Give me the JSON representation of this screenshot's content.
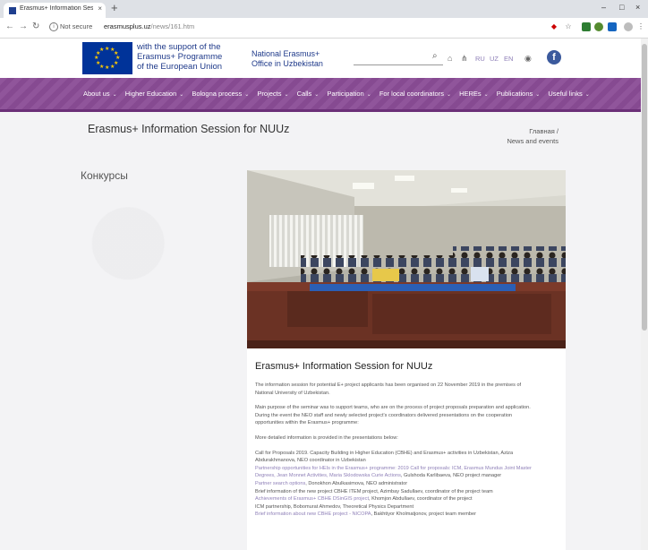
{
  "browser": {
    "tab_title": "Erasmus+ Information Session fo",
    "tab_close": "×",
    "new_tab": "+",
    "security_label": "Not secure",
    "url_host": "erasmusplus.uz",
    "url_path": "/news/161.htm",
    "window_controls": [
      "–",
      "□",
      "×"
    ]
  },
  "header": {
    "eu_text": [
      "with the support of the",
      "Erasmus+ Programme",
      "of the European Union"
    ],
    "office_text": [
      "National Erasmus+",
      "Office in Uzbekistan"
    ],
    "languages": [
      "RU",
      "UZ",
      "EN"
    ]
  },
  "nav": {
    "items": [
      "About us",
      "Higher Education",
      "Bologna process",
      "Projects",
      "Calls",
      "Participation",
      "For local coordinators",
      "HEREs",
      "Publications",
      "Useful links"
    ]
  },
  "page": {
    "title": "Erasmus+ Information Session for NUUz",
    "breadcrumb": [
      "Главная  /",
      "News and events"
    ],
    "sidebar_title": "Конкурсы"
  },
  "article": {
    "title": "Erasmus+ Information Session for NUUz",
    "intro": [
      "The information session for potential E+ project applicants has been organised on 22 November 2019 in the premises of",
      "National University of Uzbekistan."
    ],
    "purpose": [
      "Main purpose of the seminar was to support teams, who are on the process of project proposals preparation and application.",
      "During the event the NEO staff and newly selected project's coordinators delivered presentations on the cooperation",
      "opportunities within the Erasmus+ programme:"
    ],
    "more_info": "More detailed information is provided in the presentations below:",
    "list": [
      {
        "text": "Call for Proposals 2019. Capacity Building in Higher Education (CBHE) and Erasmus+ activities in Uzbekistan, Aziza",
        "link": false
      },
      {
        "text": "Abdurakhmanova, NEO coordinator in Uzbekistan",
        "link": false
      },
      {
        "text": "Partnership opportunities for HEIs in the Erasmus+ programme: 2019 Call for proposals: ICM, Erasmus Mundus Joint Master",
        "link": true
      },
      {
        "text": "Degrees, Jean Monnet Activities, Maria Sklodowska Curie Actions",
        "link": true,
        "suffix": ", Gulshoda Karlibaeva, NEO project manager"
      },
      {
        "text": "Partner search options",
        "link": true,
        "suffix": ", Donokhon Abulkasimova, NEO administrator"
      },
      {
        "text": "Brief information of the new project CBHE ITEM project, Azimbay Sadullaev, coordinator of the project team",
        "link": false
      },
      {
        "text": "Achievements of Erasmus+ CBHE DSinGIS project",
        "link": true,
        "suffix": ", Khomjon Abdullaev, coordinator of the project"
      },
      {
        "text": "ICM partnership, Bobomurat Ahmedov, Theoretical Physics Department",
        "link": false
      },
      {
        "text": "Brief information about new CBHE project - NICOPA",
        "link": true,
        "suffix": ", Bakhtiyor Kholmatjonov, project team member"
      }
    ]
  },
  "colors": {
    "nav_purple": "#8a4c96",
    "link_purple": "#8f80b8",
    "eu_blue": "#003399",
    "eu_gold": "#ffcc00",
    "facebook_blue": "#3b5a9d"
  },
  "icons": [
    "search-icon",
    "home-icon",
    "sitemap-icon",
    "eye-icon",
    "facebook-icon",
    "star-icon",
    "menu-icon",
    "back-icon",
    "forward-icon",
    "reload-icon"
  ]
}
